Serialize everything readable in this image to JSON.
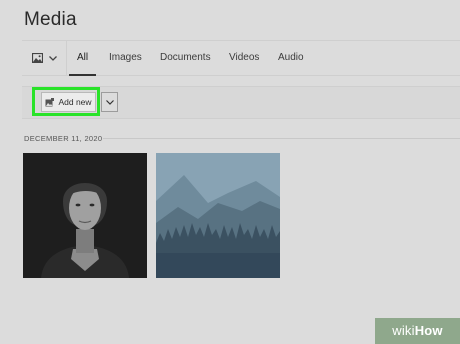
{
  "header": {
    "title": "Media"
  },
  "tabs": [
    {
      "label": "All",
      "active": true
    },
    {
      "label": "Images"
    },
    {
      "label": "Documents"
    },
    {
      "label": "Videos"
    },
    {
      "label": "Audio"
    }
  ],
  "toolbar": {
    "add_new_label": "Add new",
    "add_new_icon": "image-add-icon",
    "dropdown_icon": "chevron-down-icon"
  },
  "view_picker": {
    "icon": "image-icon",
    "dropdown_icon": "chevron-down-icon"
  },
  "gallery": {
    "date_label": "DECEMBER 11, 2020",
    "items": [
      {
        "kind": "portrait-photo"
      },
      {
        "kind": "mountain-landscape-photo"
      }
    ]
  },
  "watermark": {
    "part1": "wiki",
    "part2": "How"
  },
  "colors": {
    "highlight": "#29e329",
    "background": "#dcdcdc",
    "watermark_bg": "#8fa88c"
  }
}
